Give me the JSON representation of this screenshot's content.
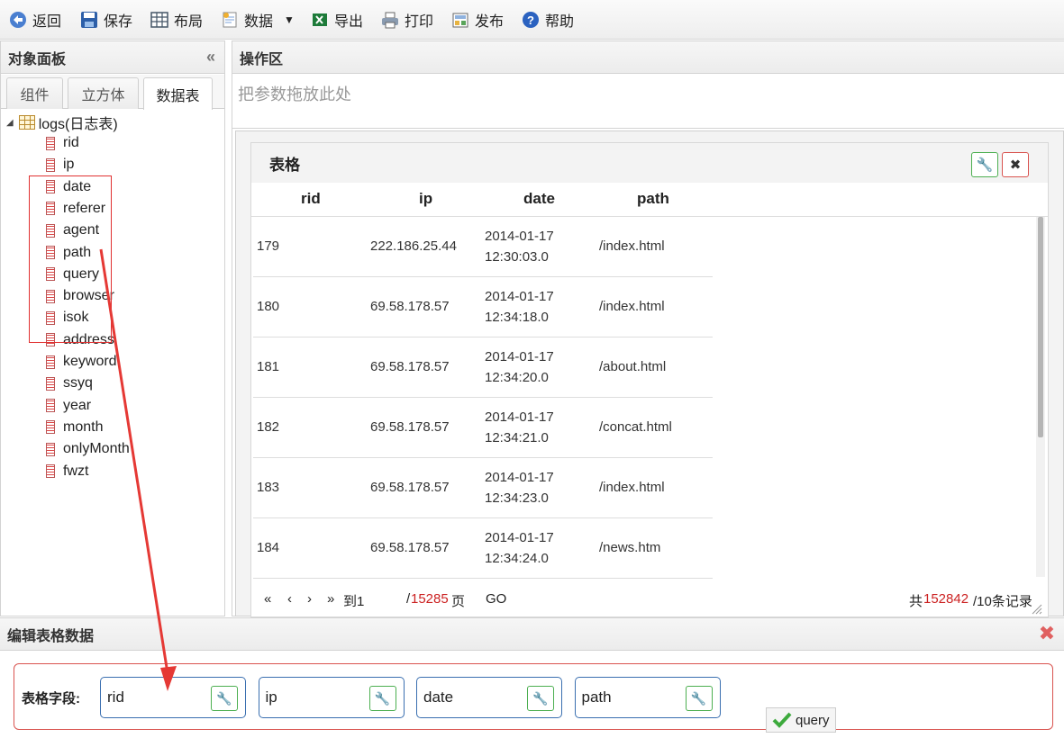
{
  "toolbar": {
    "back": "返回",
    "save": "保存",
    "layout": "布局",
    "data": "数据",
    "export": "导出",
    "print": "打印",
    "publish": "发布",
    "help": "帮助"
  },
  "left_panel": {
    "title": "对象面板",
    "tabs": [
      "组件",
      "立方体",
      "数据表"
    ],
    "active_tab": "数据表",
    "table_name": "logs(日志表)",
    "fields": [
      "rid",
      "ip",
      "date",
      "referer",
      "agent",
      "path",
      "query",
      "browser",
      "isok",
      "address",
      "keyword",
      "ssyq",
      "year",
      "month",
      "onlyMonth",
      "fwzt"
    ]
  },
  "op_area": {
    "title": "操作区",
    "drop_hint": "把参数拖放此处",
    "grid": {
      "title": "表格",
      "columns": [
        "rid",
        "ip",
        "date",
        "path"
      ],
      "rows": [
        {
          "rid": "179",
          "ip": "222.186.25.44",
          "date1": "2014-01-17",
          "date2": "12:30:03.0",
          "path": "/index.html"
        },
        {
          "rid": "180",
          "ip": "69.58.178.57",
          "date1": "2014-01-17",
          "date2": "12:34:18.0",
          "path": "/index.html"
        },
        {
          "rid": "181",
          "ip": "69.58.178.57",
          "date1": "2014-01-17",
          "date2": "12:34:20.0",
          "path": "/about.html"
        },
        {
          "rid": "182",
          "ip": "69.58.178.57",
          "date1": "2014-01-17",
          "date2": "12:34:21.0",
          "path": "/concat.html"
        },
        {
          "rid": "183",
          "ip": "69.58.178.57",
          "date1": "2014-01-17",
          "date2": "12:34:23.0",
          "path": "/index.html"
        },
        {
          "rid": "184",
          "ip": "69.58.178.57",
          "date1": "2014-01-17",
          "date2": "12:34:24.0",
          "path": "/news.htm"
        }
      ],
      "pager": {
        "first": "«",
        "prev": "‹",
        "next": "›",
        "last": "»",
        "goto_label": "到1",
        "page_sep": "/",
        "total_pages": "15285",
        "page_suffix": "页",
        "go": "GO",
        "total_prefix": "共",
        "total_records": "152842",
        "per_page": "/10条记录"
      }
    }
  },
  "editor": {
    "title": "编辑表格数据",
    "fields_label": "表格字段:",
    "chips": [
      "rid",
      "ip",
      "date",
      "path"
    ],
    "drag_tip": "query"
  },
  "colors": {
    "accent_red": "#cc2222",
    "border_blue": "#3a6fb0",
    "ok_green": "#4caf50"
  }
}
